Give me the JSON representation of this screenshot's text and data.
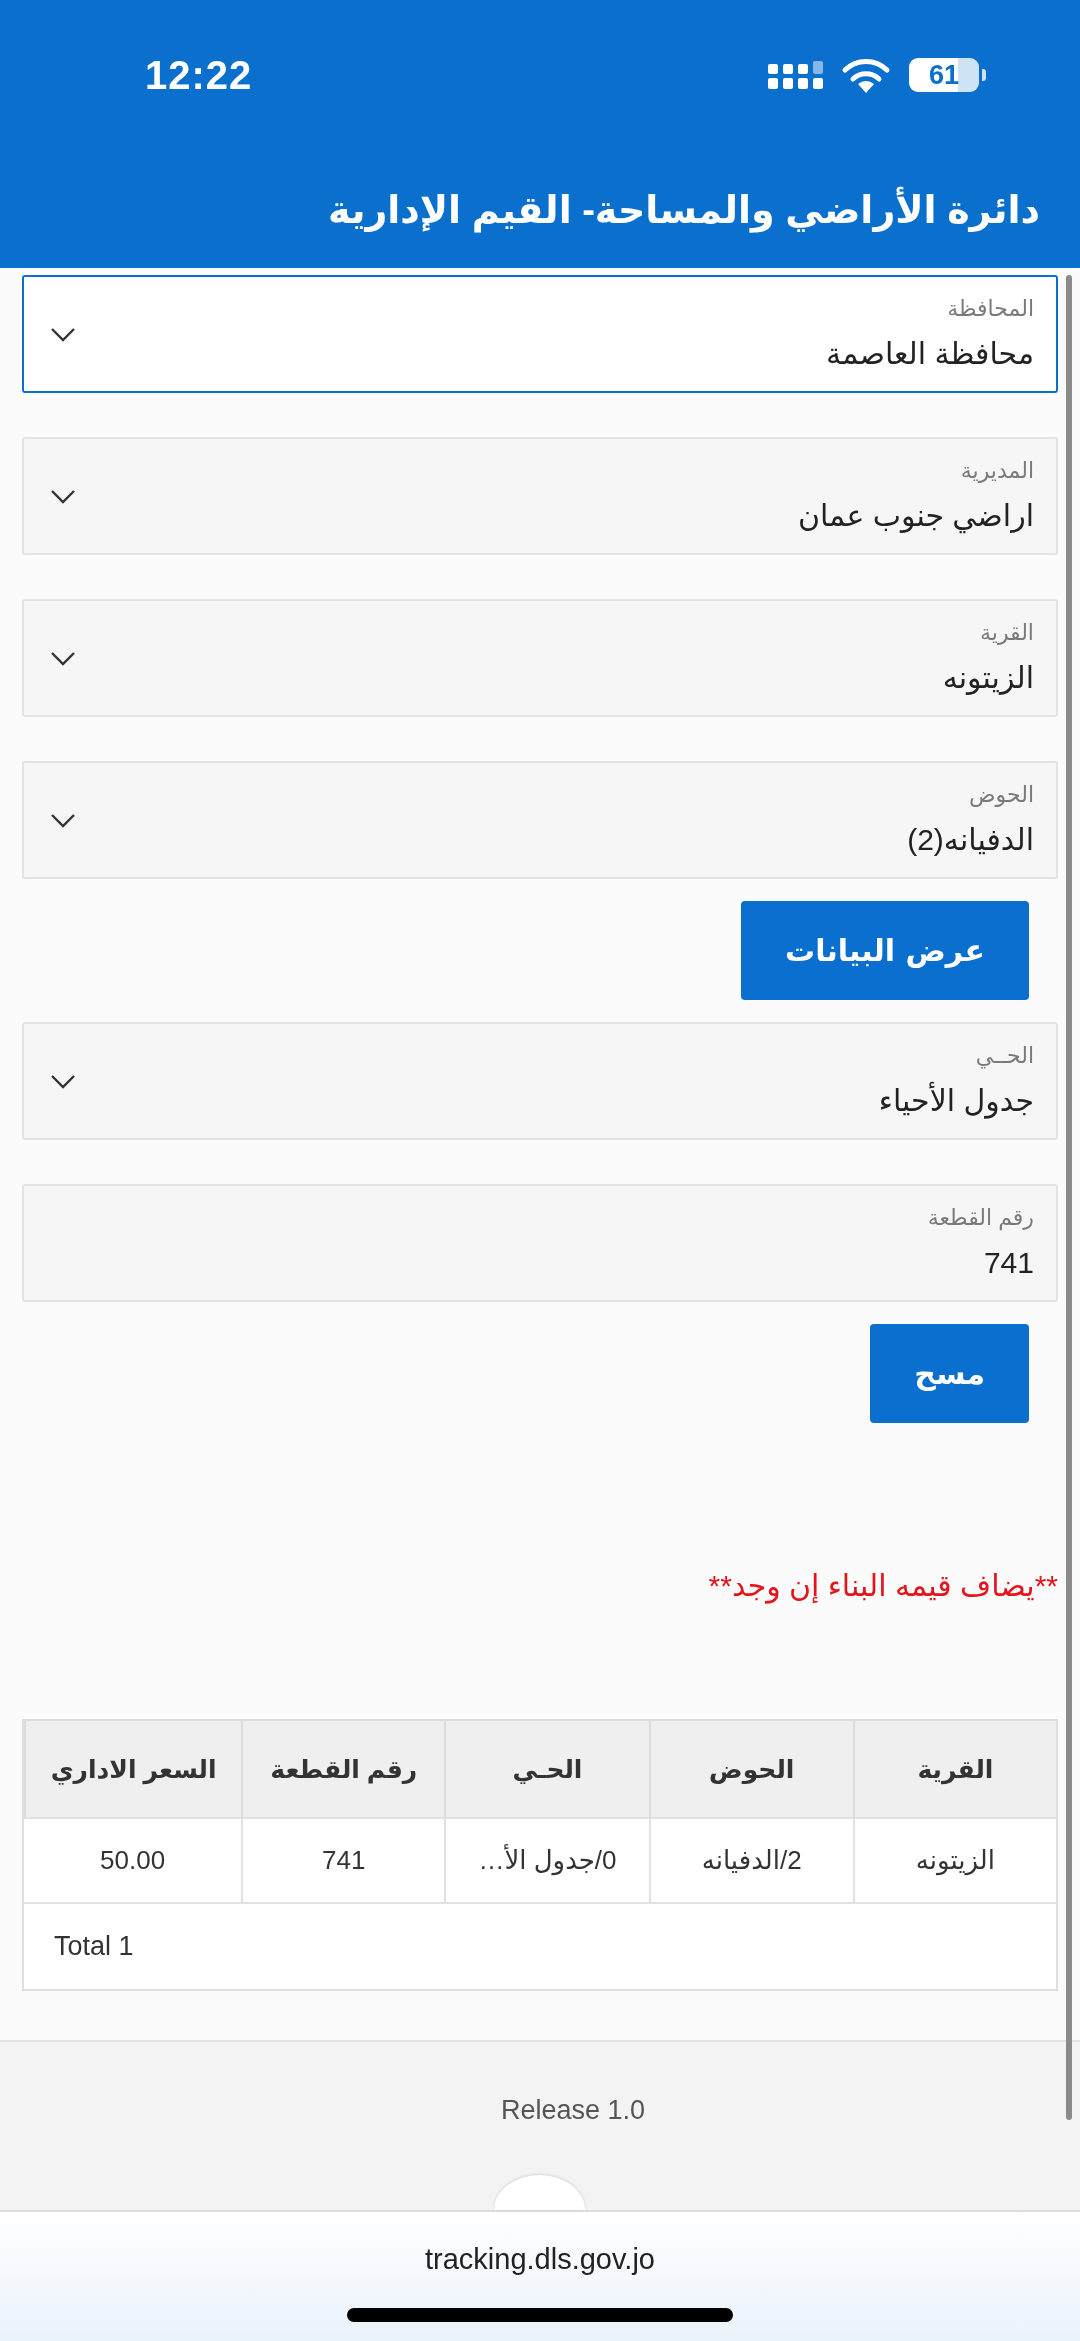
{
  "status_bar": {
    "time": "12:22",
    "battery": "61"
  },
  "header": {
    "title": "دائرة الأراضي والمساحة- القيم الإدارية"
  },
  "form_items": [
    {
      "kind": "select",
      "label": "المحافظة",
      "value": "محافظة العاصمة",
      "focused": true
    },
    {
      "kind": "select",
      "label": "المديرية",
      "value": "اراضي جنوب عمان",
      "focused": false
    },
    {
      "kind": "select",
      "label": "القرية",
      "value": "الزيتونه",
      "focused": false
    },
    {
      "kind": "select",
      "label": "الحوض",
      "value": "الدفيانه(2)",
      "focused": false
    },
    {
      "kind": "button",
      "label": "عرض البيانات"
    },
    {
      "kind": "select",
      "label": "الحــي",
      "value": "جدول الأحياء",
      "focused": false
    },
    {
      "kind": "input",
      "label": "رقم القطعة",
      "value": "741",
      "focused": false
    },
    {
      "kind": "button",
      "label": "مسح"
    }
  ],
  "note": {
    "text": "**يضاف قيمه البناء إن وجد**"
  },
  "table": {
    "columns": [
      "القرية",
      "الحوض",
      "الحـي",
      "رقم القطعة",
      "السعر الاداري"
    ],
    "rows": [
      [
        "الزيتونه",
        "2/الدفيانه",
        "0/جدول الأ…",
        "741",
        "50.00"
      ]
    ],
    "footer": "Total 1"
  },
  "footer": {
    "release": "Release 1.0"
  },
  "browser": {
    "url": "tracking.dls.gov.jo"
  }
}
